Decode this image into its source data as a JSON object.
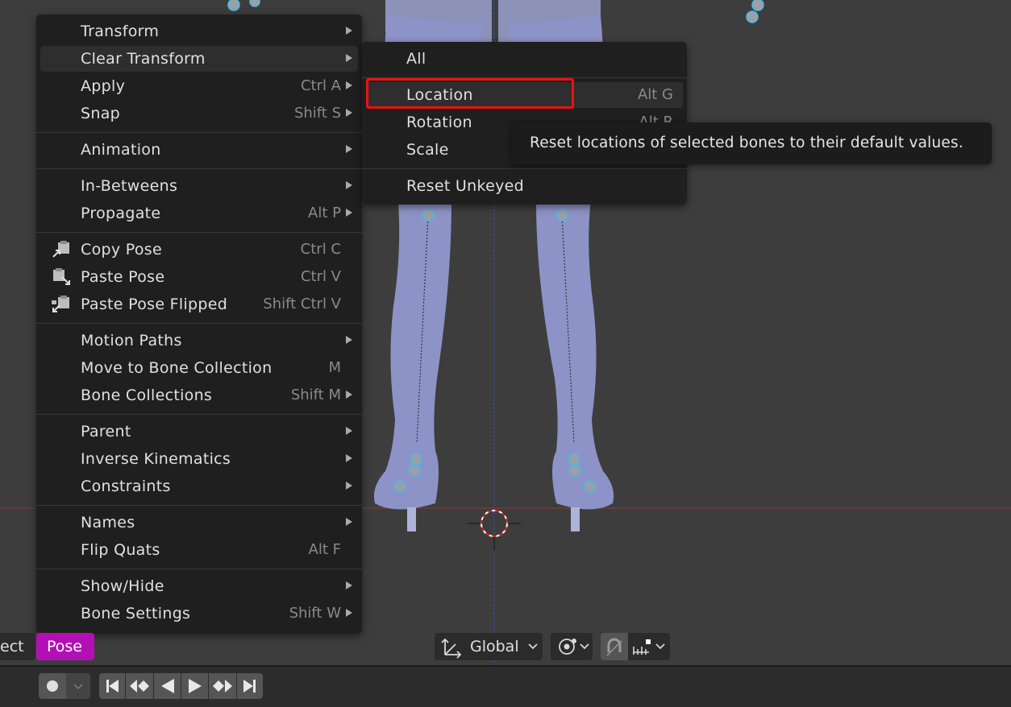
{
  "pose_menu": {
    "groups": [
      [
        {
          "label": "Transform",
          "shortcut": "",
          "submenu": true
        },
        {
          "label": "Clear Transform",
          "shortcut": "",
          "submenu": true,
          "hover": true
        },
        {
          "label": "Apply",
          "shortcut": "Ctrl A",
          "submenu": true
        },
        {
          "label": "Snap",
          "shortcut": "Shift S",
          "submenu": true
        }
      ],
      [
        {
          "label": "Animation",
          "shortcut": "",
          "submenu": true
        }
      ],
      [
        {
          "label": "In-Betweens",
          "shortcut": "",
          "submenu": true
        },
        {
          "label": "Propagate",
          "shortcut": "Alt P",
          "submenu": true
        }
      ],
      [
        {
          "label": "Copy Pose",
          "shortcut": "Ctrl C",
          "submenu": false,
          "icon": "copy-pose-icon"
        },
        {
          "label": "Paste Pose",
          "shortcut": "Ctrl V",
          "submenu": false,
          "icon": "paste-pose-icon"
        },
        {
          "label": "Paste Pose Flipped",
          "shortcut": "Shift Ctrl V",
          "submenu": false,
          "icon": "paste-pose-flipped-icon"
        }
      ],
      [
        {
          "label": "Motion Paths",
          "shortcut": "",
          "submenu": true
        },
        {
          "label": "Move to Bone Collection",
          "shortcut": "M",
          "submenu": false
        },
        {
          "label": "Bone Collections",
          "shortcut": "Shift M",
          "submenu": true
        }
      ],
      [
        {
          "label": "Parent",
          "shortcut": "",
          "submenu": true
        },
        {
          "label": "Inverse Kinematics",
          "shortcut": "",
          "submenu": true
        },
        {
          "label": "Constraints",
          "shortcut": "",
          "submenu": true
        }
      ],
      [
        {
          "label": "Names",
          "shortcut": "",
          "submenu": true
        },
        {
          "label": "Flip Quats",
          "shortcut": "Alt F",
          "submenu": false
        }
      ],
      [
        {
          "label": "Show/Hide",
          "shortcut": "",
          "submenu": true
        },
        {
          "label": "Bone Settings",
          "shortcut": "Shift W",
          "submenu": true
        }
      ]
    ]
  },
  "clear_transform_menu": {
    "groups": [
      [
        {
          "label": "All",
          "shortcut": ""
        }
      ],
      [
        {
          "label": "Location",
          "shortcut": "Alt G",
          "hover": true
        },
        {
          "label": "Rotation",
          "shortcut": "Alt R"
        },
        {
          "label": "Scale",
          "shortcut": ""
        }
      ],
      [
        {
          "label": "Reset Unkeyed",
          "shortcut": ""
        }
      ]
    ]
  },
  "tooltip": {
    "text": "Reset locations of selected bones to their default values."
  },
  "header": {
    "menu_partial": "ect",
    "menu_pose": "Pose",
    "orientation": "Global",
    "active_menu_color": "#b40fb4"
  },
  "colors": {
    "highlight_outline": "#ee1111",
    "menu_bg": "#1f1f1f",
    "viewport_bg": "#3d3d3d"
  }
}
